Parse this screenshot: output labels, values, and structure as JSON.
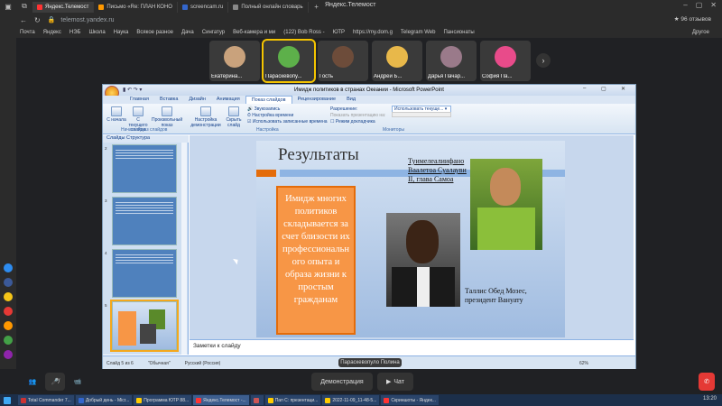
{
  "browser": {
    "tabs": [
      {
        "label": "Яндекс.Телемост",
        "color": "#f33"
      },
      {
        "label": "Письмо «Re: ПЛАН КОНО",
        "color": "#f90"
      },
      {
        "label": "screencam.ru",
        "color": "#36c"
      },
      {
        "label": "Полный онлайн словарь",
        "color": "#888"
      }
    ],
    "window_title": "Яндекс.Телемост",
    "url": "telemost.yandex.ru",
    "reviews": "★ 96 отзывов",
    "bookmarks": [
      "Почта",
      "Яндекс",
      "НЭБ",
      "Школа",
      "Наука",
      "Всякое разное",
      "Дача",
      "Сингатур",
      "Веб-камера и ми",
      "(122) Bob Ross -",
      "ЮТР",
      "https://my.dom.g",
      "Telegram Web",
      "Пансионаты"
    ],
    "bookmarks_other": "Другое"
  },
  "participants": [
    {
      "name": "Екатерина...",
      "avatar_color": "#c9a27c"
    },
    {
      "name": "Параскевопу...",
      "avatar_color": "#5db04a"
    },
    {
      "name": "Гость",
      "avatar_color": "#6d4c3a"
    },
    {
      "name": "Андрей Б...",
      "avatar_color": "#e8b84a"
    },
    {
      "name": "Дарья Пачар...",
      "avatar_color": "#9a7a8a"
    },
    {
      "name": "София Па...",
      "avatar_color": "#e84b8a"
    }
  ],
  "ppt": {
    "title": "Имидж политиков в странах Океании - Microsoft PowerPoint",
    "ribbon_tabs": [
      "Главная",
      "Вставка",
      "Дизайн",
      "Анимация",
      "Показ слайдов",
      "Рецензирование",
      "Вид"
    ],
    "active_tab": "Показ слайдов",
    "buttons": [
      "С начала",
      "С текущего слайда",
      "Произвольный показ",
      "Настройка демонстрации",
      "Скрыть слайд"
    ],
    "checks": [
      "Звукозапись",
      "Настройка времени",
      "Использовать записанные времена"
    ],
    "resolution_label": "Разрешение:",
    "resolution_value": "Использовать текуще...",
    "show_on_label": "Показать презентацию на:",
    "presenter_mode": "Режим докладчика",
    "groups": [
      "Начать показ слайдов",
      "Настройка",
      "Мониторы"
    ],
    "pane_tabs": "Слайды  Структура",
    "slide": {
      "title": "Результаты",
      "box_text": "Имидж многих политиков складывается за счет близости их профессиональн ого опыта и образа жизни к простым гражданам",
      "caption1": "Туимелеалиифано Ваалетоа Суалауви II, глава Самоа",
      "caption2": "Таллис Обед Мозес, президент Вануату"
    },
    "notes": "Заметки к слайду",
    "status_slide": "Слайд 5 из 6",
    "status_theme": "\"Обычная\"",
    "status_lang": "Русский (Россия)",
    "zoom": "62%"
  },
  "call": {
    "speaker": "Параскевопуло Полина",
    "demo_label": "Демонстрация",
    "chat_label": "Чат"
  },
  "taskbar": {
    "items": [
      "Total Commander 7...",
      "Добрый день - Micr...",
      "Программа ЮТР 88...",
      "Яндекс.Телемост -...",
      "",
      "Пап С: презентаци...",
      "2022-11-09_11-48-5...",
      "Скриншоты - Яндек..."
    ],
    "time": "13:20"
  }
}
